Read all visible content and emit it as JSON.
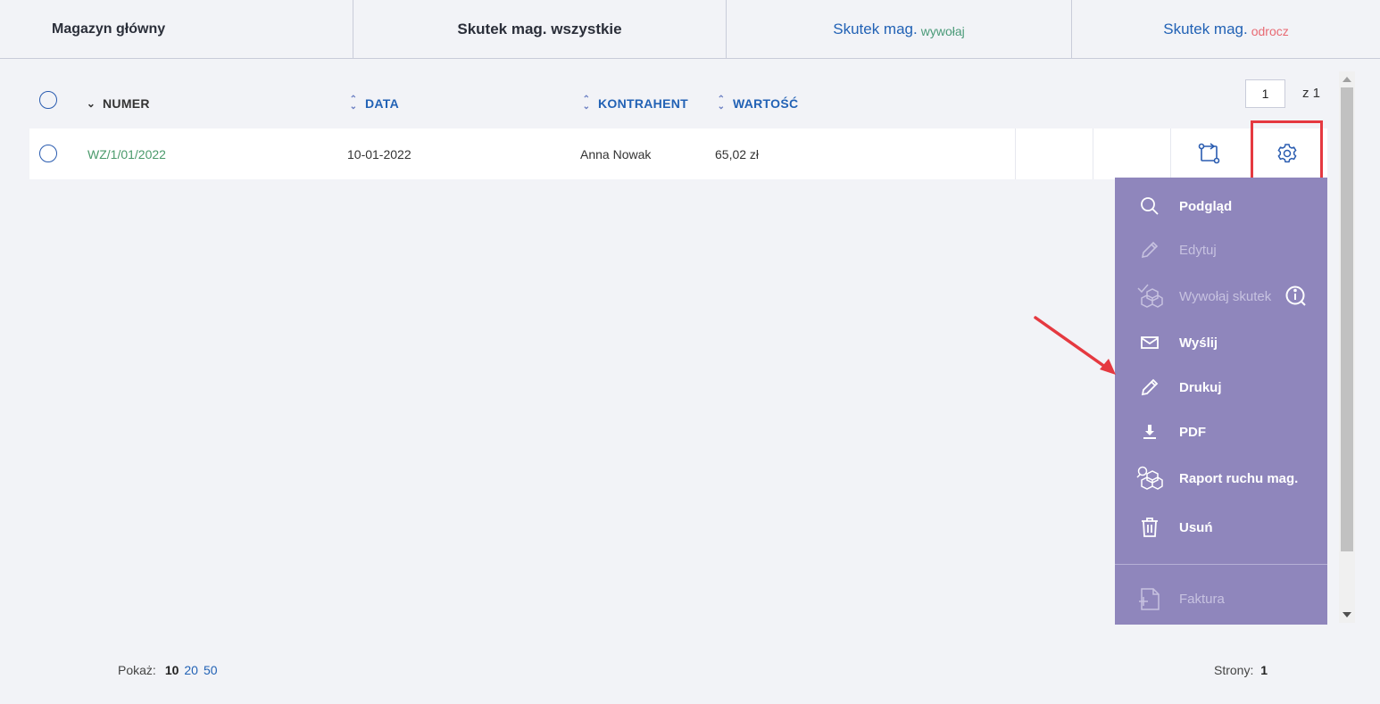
{
  "tabs": [
    {
      "label": "Magazyn główny",
      "sub": ""
    },
    {
      "label": "Skutek mag. wszystkie",
      "sub": ""
    },
    {
      "label": "Skutek mag.",
      "sub": "wywołaj"
    },
    {
      "label": "Skutek mag.",
      "sub": "odrocz"
    }
  ],
  "pagination_top": {
    "page": "1",
    "of_label": "z 1"
  },
  "table": {
    "headers": {
      "numer": "NUMER",
      "data": "DATA",
      "kontrahent": "KONTRAHENT",
      "wartosc": "WARTOŚĆ"
    },
    "rows": [
      {
        "numer": "WZ/1/01/2022",
        "data": "10-01-2022",
        "kontrahent": "Anna Nowak",
        "wartosc": "65,02 zł"
      }
    ]
  },
  "menu": {
    "items": [
      {
        "label": "Podgląd",
        "icon": "search-icon",
        "enabled": true
      },
      {
        "label": "Edytuj",
        "icon": "pencil-icon",
        "enabled": false
      },
      {
        "label": "Wywołaj skutek",
        "icon": "boxes-check-icon",
        "enabled": false
      },
      {
        "label": "Wyślij",
        "icon": "envelope-icon",
        "enabled": true
      },
      {
        "label": "Drukuj",
        "icon": "pencil-icon",
        "enabled": true
      },
      {
        "label": "PDF",
        "icon": "download-icon",
        "enabled": true
      },
      {
        "label": "Raport ruchu mag.",
        "icon": "boxes-search-icon",
        "enabled": true
      },
      {
        "label": "Usuń",
        "icon": "trash-icon",
        "enabled": true
      },
      {
        "label": "Faktura",
        "icon": "document-add-icon",
        "enabled": false
      }
    ]
  },
  "footer": {
    "show_label": "Pokaż:",
    "page_sizes": [
      "10",
      "20",
      "50"
    ],
    "current_size": "10",
    "pages_label": "Strony:",
    "pages_value": "1"
  },
  "colors": {
    "accent": "#2262b5",
    "menu_bg": "#8f86bc",
    "highlight": "#e53940",
    "doc_number": "#4a9a6b"
  }
}
